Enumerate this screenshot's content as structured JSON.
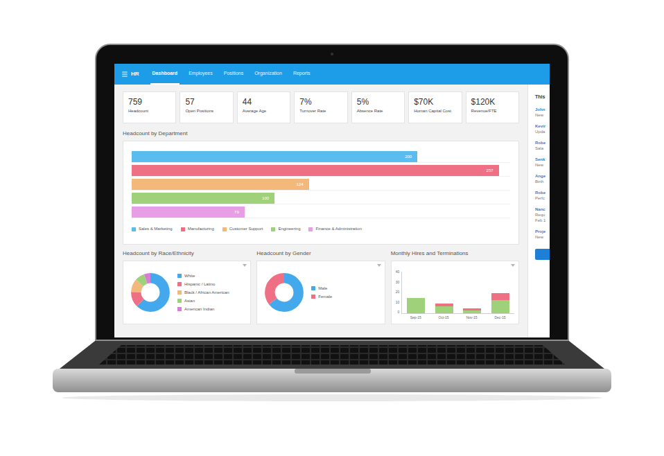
{
  "nav": {
    "brand": "HR",
    "tabs": [
      {
        "label": "Dashboard",
        "selected": true
      },
      {
        "label": "Employees",
        "selected": false
      },
      {
        "label": "Positions",
        "selected": false
      },
      {
        "label": "Organization",
        "selected": false
      },
      {
        "label": "Reports",
        "selected": false
      }
    ]
  },
  "kpis": [
    {
      "value": "759",
      "label": "Headcount"
    },
    {
      "value": "57",
      "label": "Open Positions"
    },
    {
      "value": "44",
      "label": "Average Age"
    },
    {
      "value": "7%",
      "label": "Turnover Rate"
    },
    {
      "value": "5%",
      "label": "Absence Rate"
    },
    {
      "value": "$70K",
      "label": "Human Capital Cost"
    },
    {
      "value": "$120K",
      "label": "Revenue/FTE"
    }
  ],
  "department_chart": {
    "title": "Headcount by Department",
    "series": [
      {
        "name": "Sales & Marketing",
        "value": 200,
        "label": "200",
        "color": "#5bbcf0"
      },
      {
        "name": "Manufacturing",
        "value": 257,
        "label": "257",
        "color": "#ef6f85"
      },
      {
        "name": "Customer Support",
        "value": 124,
        "label": "124",
        "color": "#f2b97a"
      },
      {
        "name": "Engineering",
        "value": 100,
        "label": "100",
        "color": "#9fd07a"
      },
      {
        "name": "Finance & Administration",
        "value": 79,
        "label": "79",
        "color": "#e79ee7"
      }
    ]
  },
  "race_chart": {
    "title": "Headcount by Race/Ethnicity",
    "segments": [
      {
        "name": "White",
        "value": 62,
        "color": "#44a9ec"
      },
      {
        "name": "Hispanic / Latino",
        "value": 13,
        "color": "#ef6f85"
      },
      {
        "name": "Black / African American",
        "value": 11,
        "color": "#f2b97a"
      },
      {
        "name": "Asian",
        "value": 8,
        "color": "#9fd07a"
      },
      {
        "name": "American Indian",
        "value": 6,
        "color": "#d77fd7"
      }
    ]
  },
  "gender_chart": {
    "title": "Headcount by Gender",
    "segments": [
      {
        "name": "Male",
        "value": 64,
        "color": "#44a9ec"
      },
      {
        "name": "Female",
        "value": 36,
        "color": "#ef6f85"
      }
    ]
  },
  "hires_chart": {
    "title": "Monthly Hires and Terminations",
    "y_ticks": [
      "40",
      "30",
      "20",
      "10",
      "0"
    ],
    "y_max": 40,
    "months": [
      "Sep-15",
      "Oct-15",
      "Nov-15",
      "Dec-15"
    ],
    "series": [
      {
        "values": [
          15,
          7,
          3,
          13
        ],
        "color": "#9fd07a"
      },
      {
        "values": [
          0,
          3,
          2,
          7
        ],
        "color": "#ef6f85"
      }
    ]
  },
  "side_panel": {
    "title": "This",
    "items": [
      {
        "name": "John",
        "lines": [
          "New"
        ]
      },
      {
        "name": "Kevir",
        "lines": [
          "Upda"
        ]
      },
      {
        "name": "Robe",
        "lines": [
          "Sala"
        ]
      },
      {
        "name": "Senk",
        "lines": [
          "New"
        ]
      },
      {
        "name": "Ange",
        "lines": [
          "Birth"
        ]
      },
      {
        "name": "Robe",
        "lines": [
          "Perfc"
        ]
      },
      {
        "name": "Nanc",
        "lines": [
          "Requ",
          "Feb 1"
        ]
      },
      {
        "name": "Proje",
        "lines": [
          "New"
        ]
      }
    ]
  }
}
